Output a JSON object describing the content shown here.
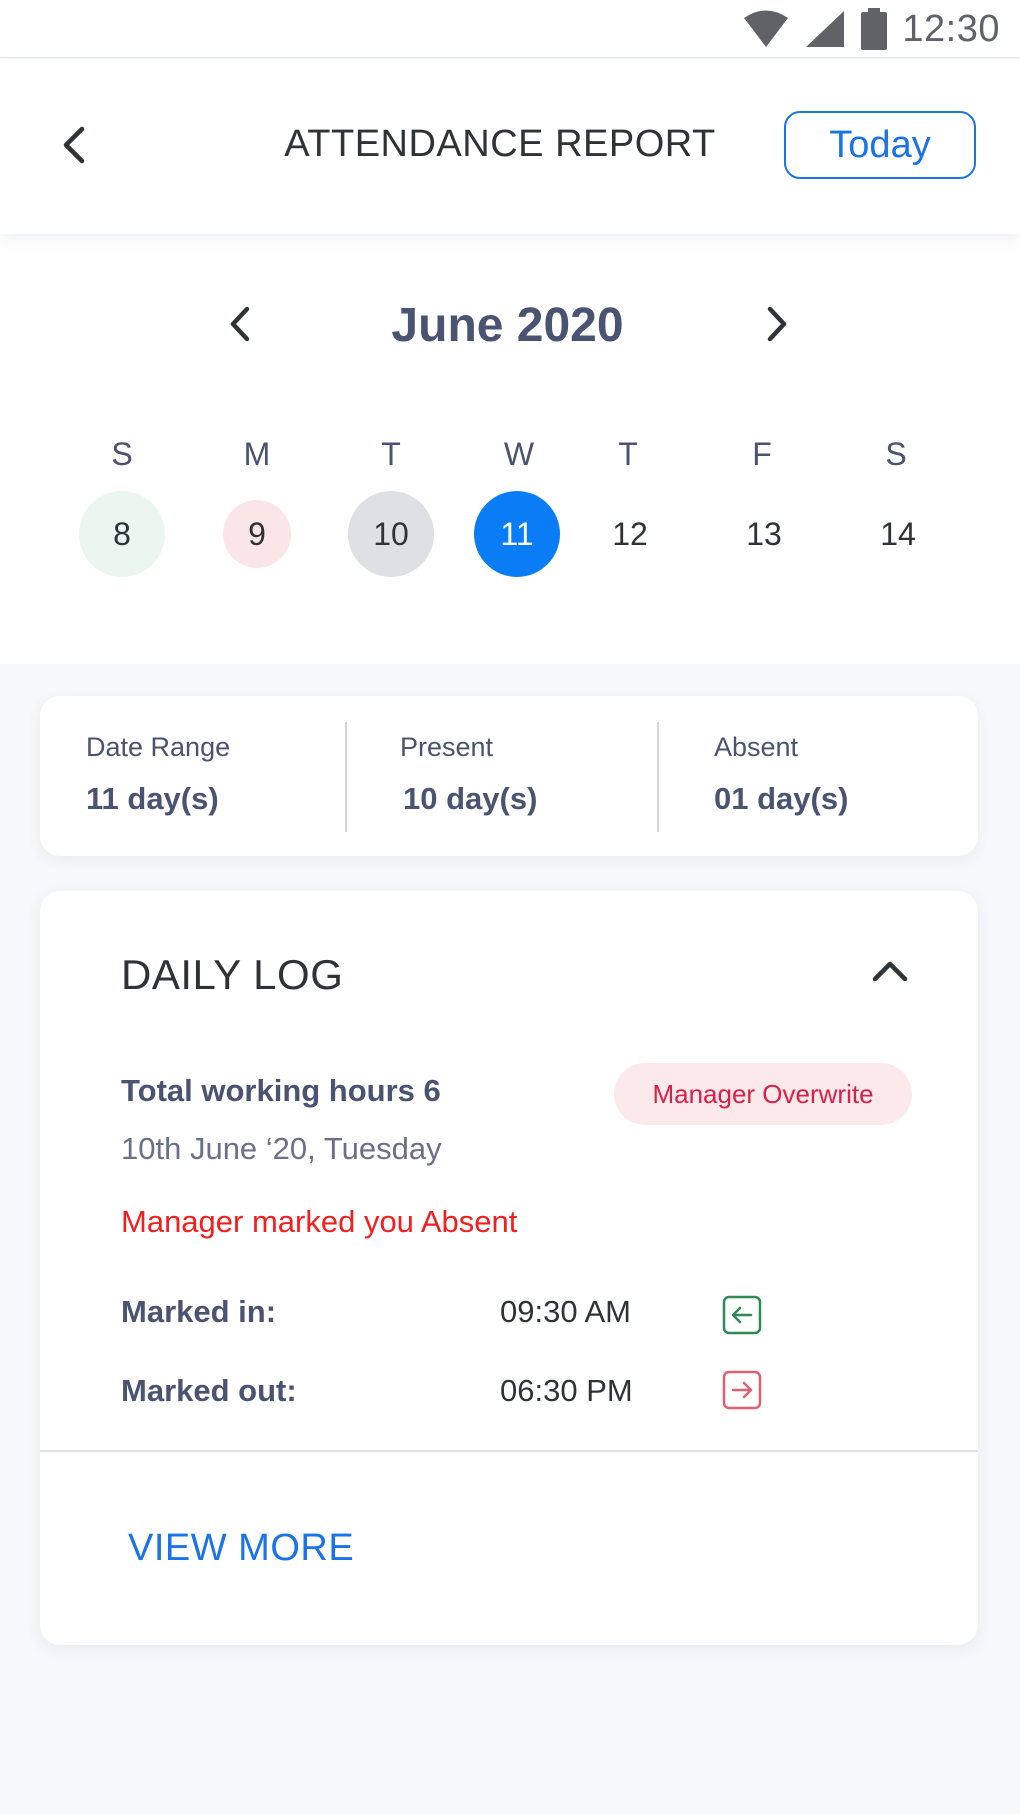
{
  "status_bar": {
    "time": "12:30",
    "icons": [
      "wifi-icon",
      "signal-icon",
      "battery-icon"
    ]
  },
  "header": {
    "title": "ATTENDANCE REPORT",
    "today_label": "Today",
    "back_icon": "chevron-left-icon"
  },
  "calendar": {
    "month_label": "June 2020",
    "weekdays": [
      "S",
      "M",
      "T",
      "W",
      "T",
      "F",
      "S"
    ],
    "days": [
      {
        "label": "8",
        "status": "present"
      },
      {
        "label": "9",
        "status": "absent"
      },
      {
        "label": "10",
        "status": "past"
      },
      {
        "label": "11",
        "status": "selected"
      },
      {
        "label": "12",
        "status": "none"
      },
      {
        "label": "13",
        "status": "none"
      },
      {
        "label": "14",
        "status": "none"
      }
    ]
  },
  "summary": {
    "date_range_label": "Date Range",
    "date_range_value": "11 day(s)",
    "present_label": "Present",
    "present_value": "10 day(s)",
    "absent_label": "Absent",
    "absent_value": "01 day(s)"
  },
  "daily_log": {
    "title": "DAILY LOG",
    "total_hours": "Total working hours 6",
    "date": "10th June ‘20, Tuesday",
    "badge": "Manager Overwrite",
    "absent_message": "Manager marked you Absent",
    "marked_in_label": "Marked in:",
    "marked_in_time": "09:30 AM",
    "marked_out_label": "Marked out:",
    "marked_out_time": "06:30 PM",
    "view_more": "VIEW MORE"
  },
  "colors": {
    "accent": "#1a73e8",
    "selected_day": "#0a7cf5",
    "present_bg": "#eaf6ef",
    "absent_bg": "#fae6e7",
    "alert_red": "#f41e1e",
    "badge_text": "#d8204a",
    "mark_in_green": "#2e8b57",
    "mark_out_red": "#e06070"
  }
}
